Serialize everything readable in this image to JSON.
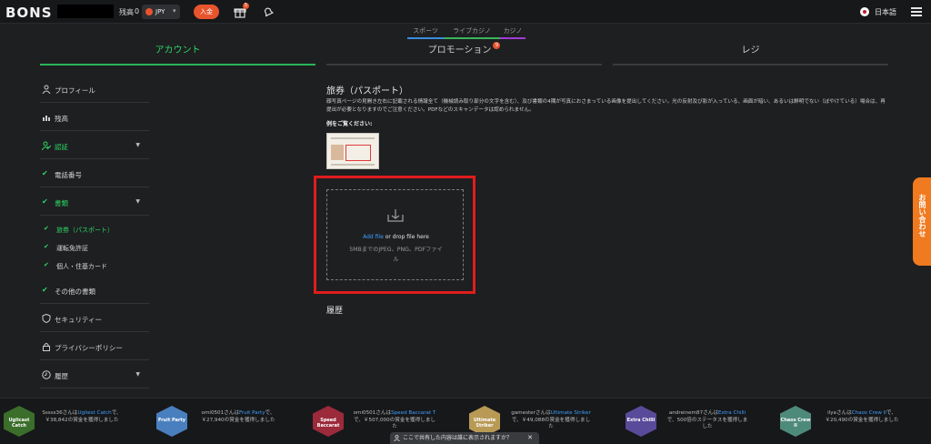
{
  "header": {
    "logo": "BONS",
    "balance_label": "残高",
    "balance_value": "0",
    "currency": "JPY",
    "deposit_label": "入金",
    "gift_badge": "5",
    "language": "日本語"
  },
  "categories": [
    "スポーツ",
    "ライブカジノ",
    "カジノ"
  ],
  "sections": {
    "account": "アカウント",
    "promotions": "プロモーション",
    "promo_badge": "9",
    "cashier": "レジ"
  },
  "sidebar": {
    "profile": "プロフィール",
    "balance": "残高",
    "verification": "認証",
    "phone": "電話番号",
    "documents": "書類",
    "passport": "旅券（パスポート）",
    "license": "運転免許証",
    "id_card": "個人・住基カード",
    "other_docs": "その他の書類",
    "security": "セキュリティー",
    "privacy": "プライバシーポリシー",
    "history": "履歴"
  },
  "main": {
    "title": "旅券（パスポート）",
    "description": "顔写真ページの見開き左右に記載される情報全て（機械読み取り部分の文字を含む）、及び書類の4隅が写真におさまっている画像を提出してください。光の反射及び影が入っている、画面が暗い、あるいは鮮明でない（ぼやけている）場合は、再提出が必要となりますのでご注意ください。PDFなどのスキャンデータは認められません。",
    "example_label": "例をご覧ください:",
    "upload_add": "Add file",
    "upload_drop": " or drop file here",
    "upload_hint": "5MBまでのJPEG、PNG、PDFファイル",
    "history_title": "履歴"
  },
  "contact_tab": "お問い合わせ",
  "winners": [
    {
      "game": "Uglicast Catch",
      "text_pre": "Sssss36さんは",
      "game_label": "Ugliest Catch",
      "text_post": "で、￥38,842の賞金を獲得しました",
      "color": "#3b6e2a"
    },
    {
      "game": "Fruit Party",
      "text_pre": "omi0501さんは",
      "game_label": "Fruit Party",
      "text_post": "で、￥27,940の賞金を獲得しました",
      "color": "#4a7fbf"
    },
    {
      "game": "Speed Baccarat",
      "text_pre": "omi0501さんは",
      "game_label": "Speed Baccarat T",
      "text_post": "で、￥507,000の賞金を獲得しました",
      "color": "#9b2a3b"
    },
    {
      "game": "Ultimate Striker",
      "text_pre": "gamesterさんは",
      "game_label": "Ultimate Striker",
      "text_post": "で、￥49,088の賞金を獲得しました",
      "color": "#b89a55"
    },
    {
      "game": "Extra Chilli",
      "text_pre": "andreinem87さんは",
      "game_label": "Extra Chilli",
      "text_post": "で、500倍のステータスを獲得しました",
      "color": "#5a4a9a"
    },
    {
      "game": "Chaos Crew II",
      "text_pre": "ilyaさんは",
      "game_label": "Chaos Crew II",
      "text_post": "で、￥20,490の賞金を獲得しました",
      "color": "#4e8a7a"
    }
  ],
  "share_bar": "ここで共有した内容は誰に表示されますか？"
}
